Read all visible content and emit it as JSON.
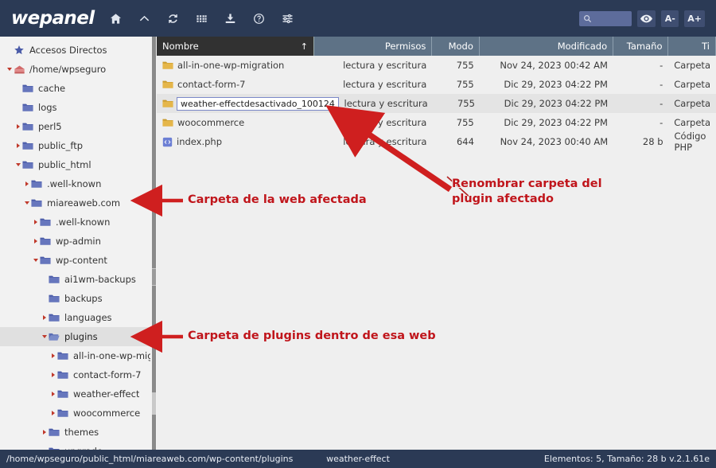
{
  "toolbar": {
    "brand": "wepanel",
    "icons": [
      {
        "name": "home-icon",
        "label": "Inicio"
      },
      {
        "name": "chevron-up-icon",
        "label": "Subir"
      },
      {
        "name": "refresh-icon",
        "label": "Recargar"
      },
      {
        "name": "grid-icon",
        "label": "Vista"
      },
      {
        "name": "download-icon",
        "label": "Descargar"
      },
      {
        "name": "help-icon",
        "label": "Ayuda"
      },
      {
        "name": "settings-sliders-icon",
        "label": "Ajustes"
      }
    ],
    "search_placeholder": "",
    "search_value": "",
    "eye_icon": "eye-icon",
    "font_decrease": "A-",
    "font_increase": "A+",
    "bg_color": "#2b3a55",
    "accent_color": "#5d6c9b"
  },
  "sidebar": {
    "items": [
      {
        "label": "Accesos Directos",
        "depth": 0,
        "icon": "star-icon",
        "caret": "none",
        "selected": false
      },
      {
        "label": "/home/wpseguro",
        "depth": 0,
        "icon": "home-folder-icon",
        "caret": "open",
        "selected": false
      },
      {
        "label": "cache",
        "depth": 1,
        "icon": "folder-icon",
        "caret": "none",
        "selected": false
      },
      {
        "label": "logs",
        "depth": 1,
        "icon": "folder-icon",
        "caret": "none",
        "selected": false
      },
      {
        "label": "perl5",
        "depth": 1,
        "icon": "folder-icon",
        "caret": "closed",
        "selected": false
      },
      {
        "label": "public_ftp",
        "depth": 1,
        "icon": "folder-icon",
        "caret": "closed",
        "selected": false
      },
      {
        "label": "public_html",
        "depth": 1,
        "icon": "folder-icon",
        "caret": "open",
        "selected": false
      },
      {
        "label": ".well-known",
        "depth": 2,
        "icon": "folder-icon",
        "caret": "closed",
        "selected": false
      },
      {
        "label": "miareaweb.com",
        "depth": 2,
        "icon": "folder-icon",
        "caret": "open",
        "selected": false
      },
      {
        "label": ".well-known",
        "depth": 3,
        "icon": "folder-icon",
        "caret": "closed",
        "selected": false
      },
      {
        "label": "wp-admin",
        "depth": 3,
        "icon": "folder-icon",
        "caret": "closed",
        "selected": false
      },
      {
        "label": "wp-content",
        "depth": 3,
        "icon": "folder-icon",
        "caret": "open",
        "selected": false
      },
      {
        "label": "ai1wm-backups",
        "depth": 4,
        "icon": "folder-icon",
        "caret": "none",
        "selected": false
      },
      {
        "label": "backups",
        "depth": 4,
        "icon": "folder-icon",
        "caret": "none",
        "selected": false
      },
      {
        "label": "languages",
        "depth": 4,
        "icon": "folder-icon",
        "caret": "closed",
        "selected": false
      },
      {
        "label": "plugins",
        "depth": 4,
        "icon": "folder-open-icon",
        "caret": "open",
        "selected": true
      },
      {
        "label": "all-in-one-wp-migr",
        "depth": 5,
        "icon": "folder-icon",
        "caret": "closed",
        "selected": false
      },
      {
        "label": "contact-form-7",
        "depth": 5,
        "icon": "folder-icon",
        "caret": "closed",
        "selected": false
      },
      {
        "label": "weather-effect",
        "depth": 5,
        "icon": "folder-icon",
        "caret": "closed",
        "selected": false
      },
      {
        "label": "woocommerce",
        "depth": 5,
        "icon": "folder-icon",
        "caret": "closed",
        "selected": false
      },
      {
        "label": "themes",
        "depth": 4,
        "icon": "folder-icon",
        "caret": "closed",
        "selected": false
      },
      {
        "label": "upgrade",
        "depth": 4,
        "icon": "folder-icon",
        "caret": "none",
        "selected": false
      }
    ]
  },
  "filelist": {
    "columns": [
      {
        "key": "name",
        "label": "Nombre",
        "active": true,
        "sort": "↑"
      },
      {
        "key": "perm",
        "label": "Permisos",
        "active": false,
        "sort": ""
      },
      {
        "key": "mode",
        "label": "Modo",
        "active": false,
        "sort": ""
      },
      {
        "key": "mod",
        "label": "Modificado",
        "active": false,
        "sort": ""
      },
      {
        "key": "size",
        "label": "Tamaño",
        "active": false,
        "sort": ""
      },
      {
        "key": "type",
        "label": "Ti",
        "active": false,
        "sort": ""
      }
    ],
    "rows": [
      {
        "name": "all-in-one-wp-migration",
        "icon": "folder-icon",
        "perm": "lectura y escritura",
        "mode": "755",
        "mod": "Nov 24, 2023 00:42 AM",
        "size": "-",
        "type": "Carpeta",
        "selected": false,
        "renaming": false
      },
      {
        "name": "contact-form-7",
        "icon": "folder-icon",
        "perm": "lectura y escritura",
        "mode": "755",
        "mod": "Dic 29, 2023 04:22 PM",
        "size": "-",
        "type": "Carpeta",
        "selected": false,
        "renaming": false
      },
      {
        "name": "weather-effectdesactivado_100124",
        "icon": "folder-icon",
        "perm": "lectura y escritura",
        "mode": "755",
        "mod": "Dic 29, 2023 04:22 PM",
        "size": "-",
        "type": "Carpeta",
        "selected": true,
        "renaming": true
      },
      {
        "name": "woocommerce",
        "icon": "folder-icon",
        "perm": "lectura y escritura",
        "mode": "755",
        "mod": "Dic 29, 2023 04:22 PM",
        "size": "-",
        "type": "Carpeta",
        "selected": false,
        "renaming": false
      },
      {
        "name": "index.php",
        "icon": "php-file-icon",
        "perm": "lectura y escritura",
        "mode": "644",
        "mod": "Nov 24, 2023 00:40 AM",
        "size": "28 b",
        "type": "Código PHP",
        "selected": false,
        "renaming": false
      }
    ]
  },
  "statusbar": {
    "path": "/home/wpseguro/public_html/miareaweb.com/wp-content/plugins",
    "selection": "weather-effect",
    "info": "Elementos: 5, Tamaño: 28 b v.2.1.61e"
  },
  "annotations": {
    "color": "#c0151b",
    "web_folder": "Carpeta de la web afectada",
    "rename": "Renombrar carpeta del\nplugin afectado",
    "plugins_folder": "Carpeta de plugins dentro de esa web"
  }
}
